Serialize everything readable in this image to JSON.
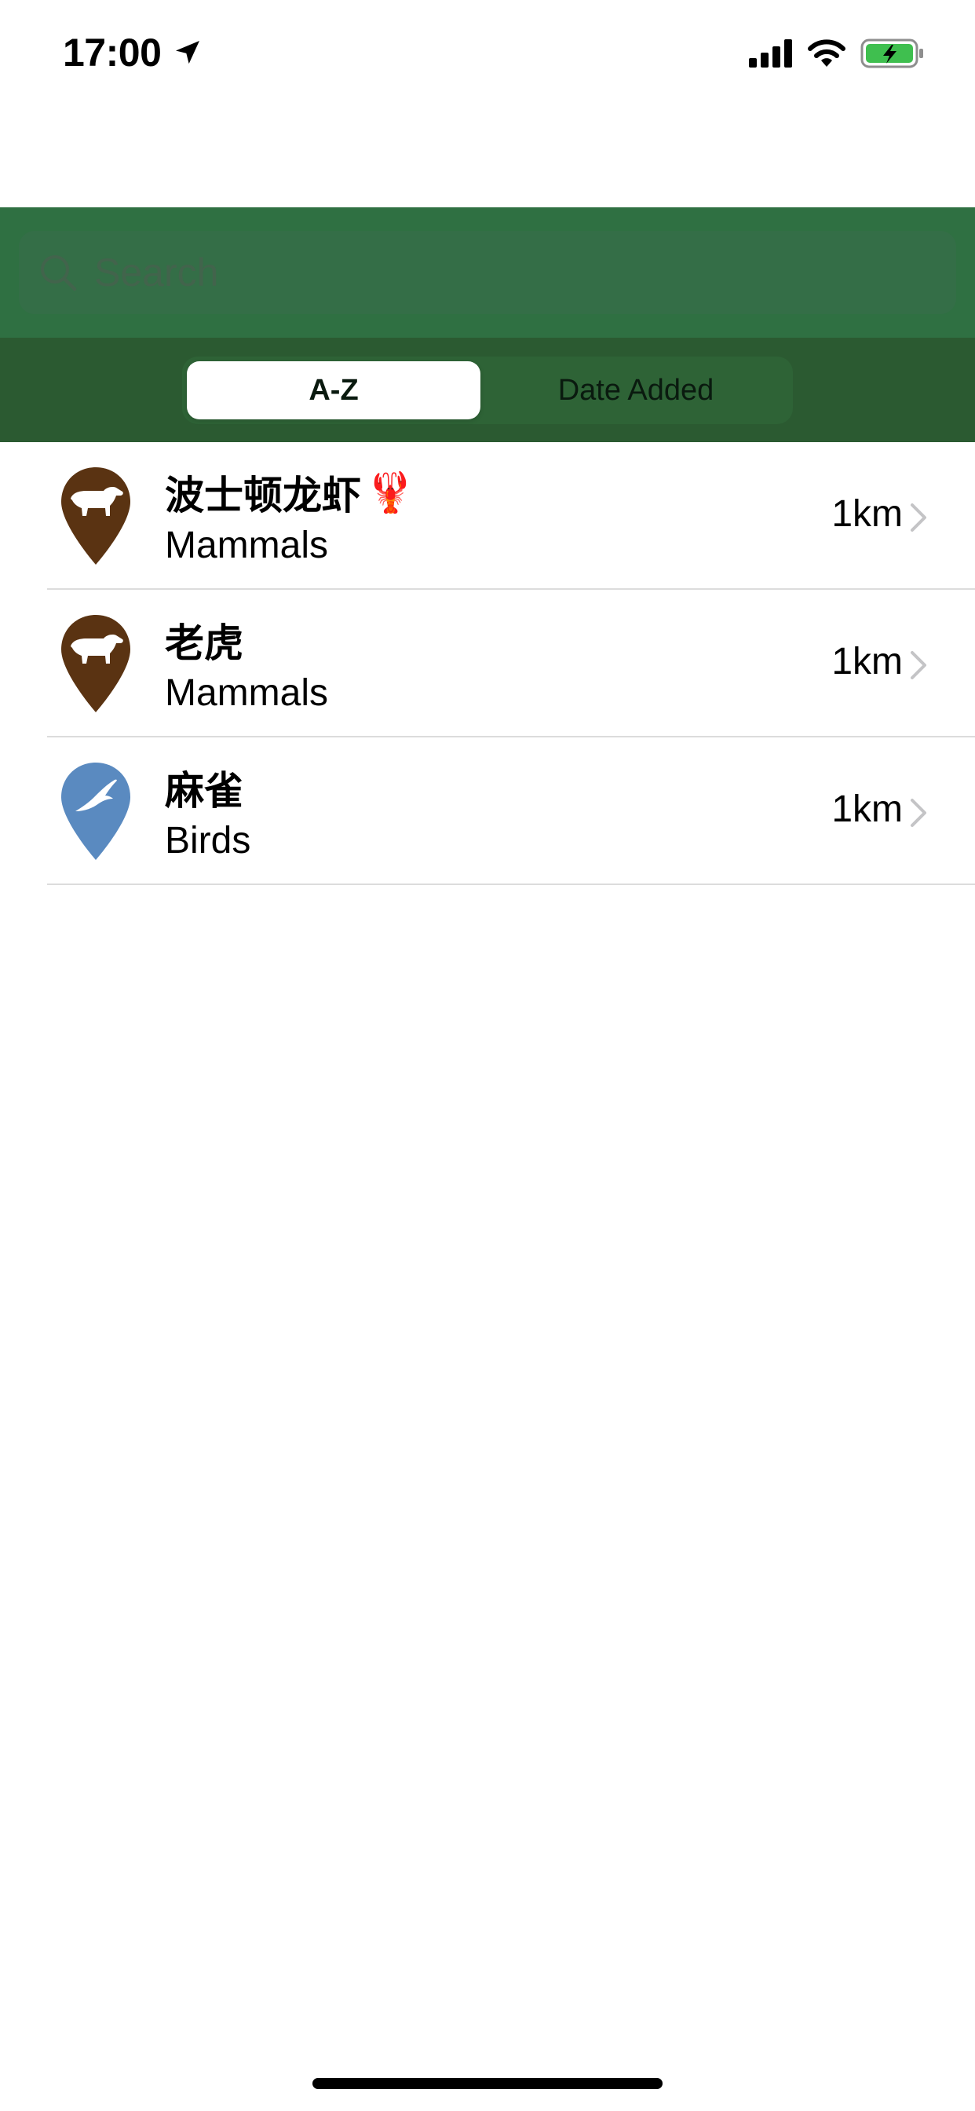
{
  "status_bar": {
    "time": "17:00",
    "location_icon": "location-arrow-icon",
    "signal_icon": "cellular-signal-icon",
    "wifi_icon": "wifi-icon",
    "battery_icon": "battery-charging-icon",
    "battery_color": "#3fbf4f"
  },
  "header": {
    "background_color": "#2f7042",
    "search": {
      "placeholder": "Search",
      "value": "",
      "icon": "search-icon"
    },
    "segments": [
      {
        "label": "A-Z",
        "selected": true
      },
      {
        "label": "Date Added",
        "selected": false
      }
    ]
  },
  "list": {
    "items": [
      {
        "title": "波士顿龙虾",
        "title_emoji": "🦞",
        "category": "Mammals",
        "distance": "1km",
        "icon": "mammal-pin-icon",
        "pin_color": "#5a3312"
      },
      {
        "title": "老虎",
        "title_emoji": "",
        "category": "Mammals",
        "distance": "1km",
        "icon": "mammal-pin-icon",
        "pin_color": "#5a3312"
      },
      {
        "title": "麻雀",
        "title_emoji": "",
        "category": "Birds",
        "distance": "1km",
        "icon": "bird-pin-icon",
        "pin_color": "#5a8ac0"
      }
    ]
  }
}
